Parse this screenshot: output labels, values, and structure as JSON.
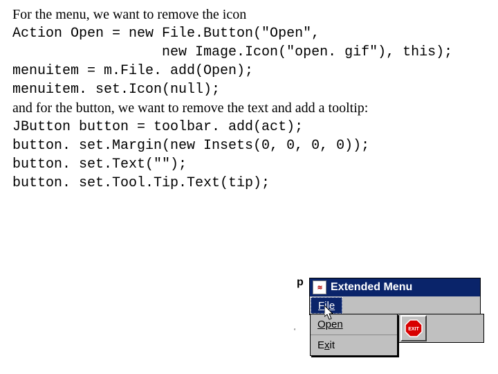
{
  "text": {
    "intro": "For the menu, we want to remove the icon",
    "code1_l1": "Action Open = new File.Button(\"Open\",",
    "code1_l2": "                  new Image.Icon(\"open. gif\"), this);",
    "code1_l3": "menuitem = m.File. add(Open);",
    "code1_l4": "menuitem. set.Icon(null);",
    "mid": "and for the button, we want to remove the text and add a tooltip:",
    "code2_l1": "JButton button = toolbar. add(act);",
    "code2_l2": "button. set.Margin(new Insets(0, 0, 0, 0));",
    "code2_l3": "button. set.Text(\"\");",
    "code2_l4": "button. set.Tool.Tip.Text(tip);"
  },
  "swing": {
    "java_icon_label": "≋",
    "title": "Extended Menu",
    "menubar_file": "File",
    "dropdown": {
      "open": "Open",
      "exit": "Exit"
    },
    "exit_button_label": "EXIT",
    "crop_char": "p"
  }
}
